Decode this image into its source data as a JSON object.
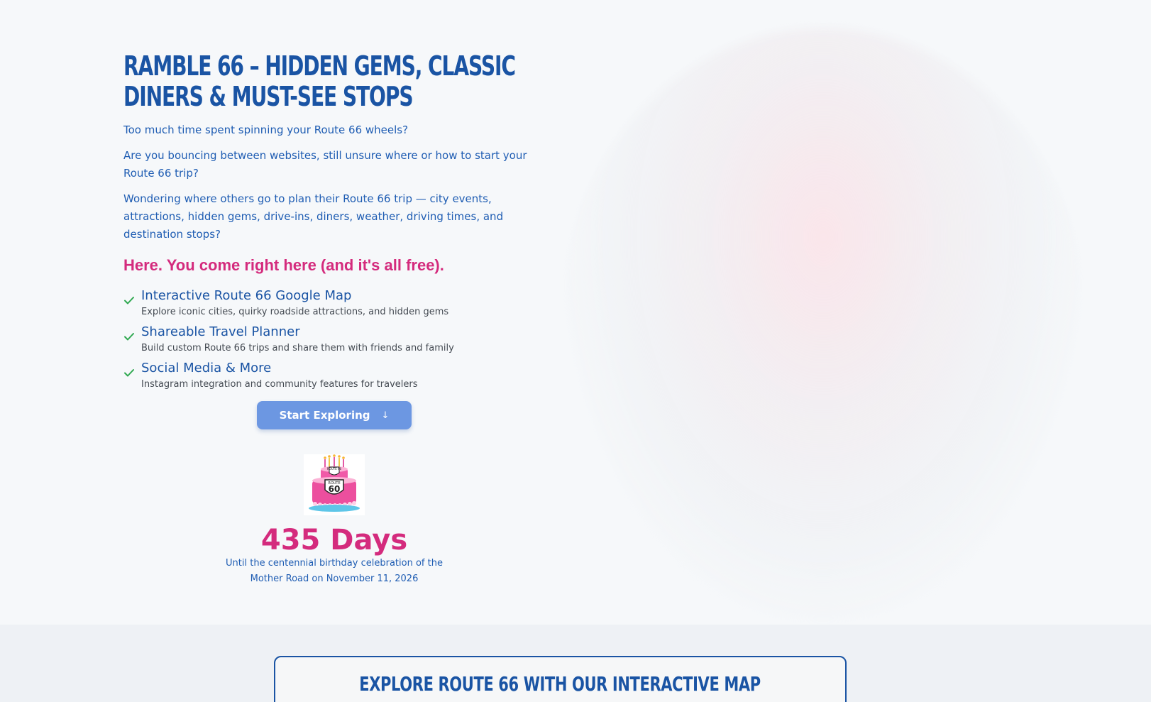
{
  "hero": {
    "title": "Ramble 66 – Hidden Gems, Classic Diners & Must-See Stops",
    "paragraphs": [
      "Too much time spent spinning your Route 66 wheels?",
      "Are you bouncing between websites, still unsure where or how to start your Route 66 trip?",
      "Wondering where others go to plan their Route 66 trip — city events, attractions, hidden gems, drive-ins, diners, weather, driving times, and destination stops?"
    ],
    "highlight": "Here. You come right here (and it's all free).",
    "features": [
      {
        "title": "Interactive Route 66 Google Map",
        "description": "Explore iconic cities, quirky roadside attractions, and hidden gems"
      },
      {
        "title": "Shareable Travel Planner",
        "description": "Build custom Route 66 trips and share them with friends and family"
      },
      {
        "title": "Social Media & More",
        "description": "Instagram integration and community features for travelers"
      }
    ],
    "cta_label": "Start Exploring",
    "cta_icon": "arrow-down-icon",
    "cake": {
      "shield_top": "ROUTE 66",
      "shield_main_top": "ROUTE",
      "shield_main_number": "60"
    },
    "countdown": "435 Days",
    "countdown_caption": "Until the centennial birthday celebration of the Mother Road on November 11, 2026"
  },
  "map_section": {
    "title": "Explore Route 66 with our Interactive Map"
  },
  "colors": {
    "primary_blue": "#1a54a4",
    "pink": "#d42b7d",
    "button": "#6c97e2",
    "check_green": "#2ea84f"
  }
}
